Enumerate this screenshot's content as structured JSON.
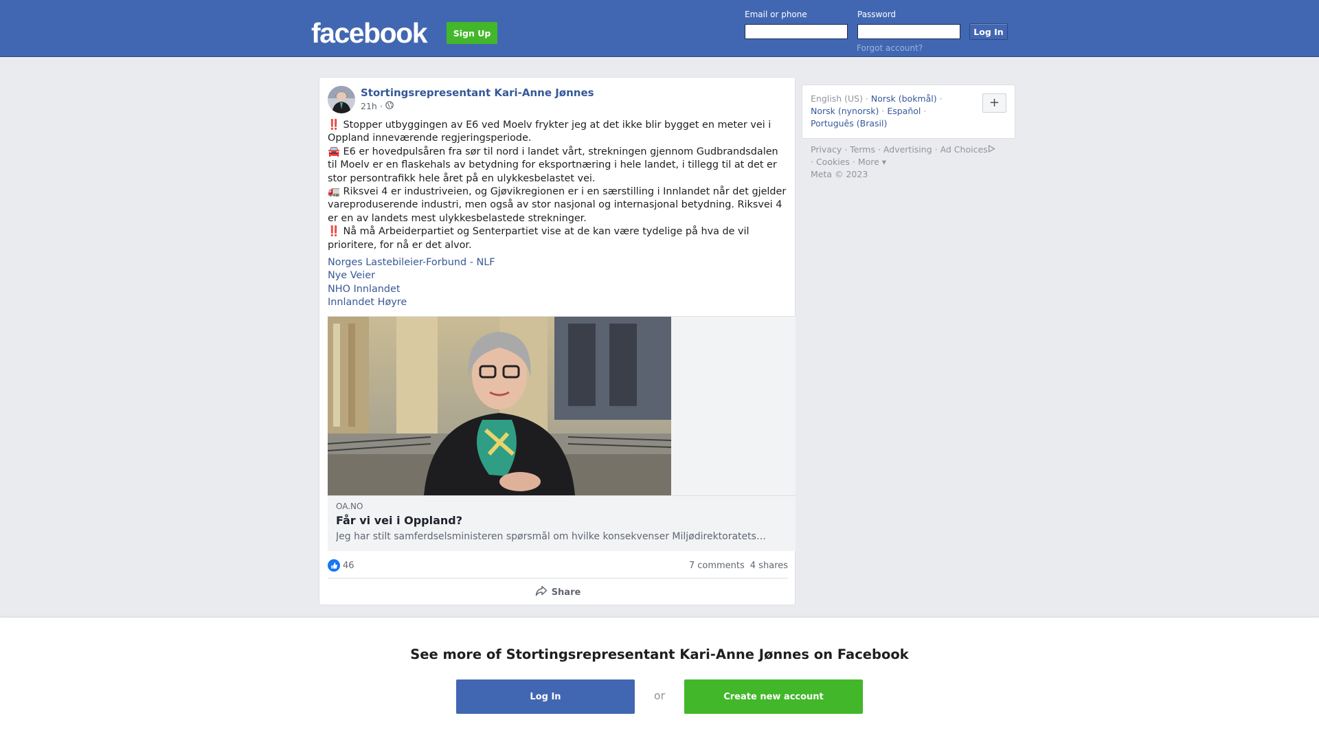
{
  "header": {
    "logo": "facebook",
    "signup_label": "Sign Up",
    "email_label": "Email or phone",
    "password_label": "Password",
    "login_label": "Log In",
    "forgot_label": "Forgot account?"
  },
  "post": {
    "author": "Stortingsrepresentant Kari-Anne Jønnes",
    "time": "21h",
    "audience_icon": "globe-icon",
    "paragraphs": [
      "‼️ Stopper utbyggingen av E6 ved Moelv frykter jeg at det ikke blir bygget en meter vei i Oppland inneværende regjeringsperiode.",
      "🚘 E6 er hovedpulsåren fra sør til nord i landet vårt, strekningen gjennom Gudbrandsdalen til Moelv er en flaskehals av betydning for eksportnæring i hele landet, i tillegg til at det er stor persontrafikk hele året på en ulykkesbelastet vei.",
      "🚛 Riksvei 4 er industriveien, og Gjøvikregionen er i en særstilling i Innlandet når det gjelder vareproduserende industri, men også av stor nasjonal og internasjonal betydning. Riksvei 4 er en av landets mest ulykkesbelastede strekninger.",
      "‼️ Nå må Arbeiderpartiet og Senterpartiet vise at de kan være tydelige på hva de vil prioritere, for nå er det alvor."
    ],
    "tags": [
      "Norges Lastebileier-Forbund - NLF",
      "Nye Veier",
      "NHO Innlandet",
      "Innlandet Høyre"
    ],
    "link": {
      "domain": "OA.NO",
      "title": "Får vi vei i Oppland?",
      "description": "Jeg har stilt samferdselsministeren spørsmål om hvilke konsekvenser Miljødirektoratets…"
    },
    "reactions_count": "46",
    "comments": "7 comments",
    "shares": "4 shares",
    "share_label": "Share"
  },
  "sidebar": {
    "languages": [
      {
        "label": "English (US)",
        "current": true
      },
      {
        "label": "Norsk (bokmål)",
        "current": false
      },
      {
        "label": "Norsk (nynorsk)",
        "current": false
      },
      {
        "label": "Español",
        "current": false
      },
      {
        "label": "Português (Brasil)",
        "current": false
      }
    ],
    "plus_label": "+",
    "footer": {
      "privacy": "Privacy",
      "terms": "Terms",
      "advertising": "Advertising",
      "ad_choices": "Ad Choices",
      "cookies": "Cookies",
      "more": "More",
      "copyright": "Meta © 2023"
    }
  },
  "banner": {
    "title": "See more of Stortingsrepresentant Kari-Anne Jønnes on Facebook",
    "login_label": "Log In",
    "or_label": "or",
    "create_label": "Create new account"
  }
}
